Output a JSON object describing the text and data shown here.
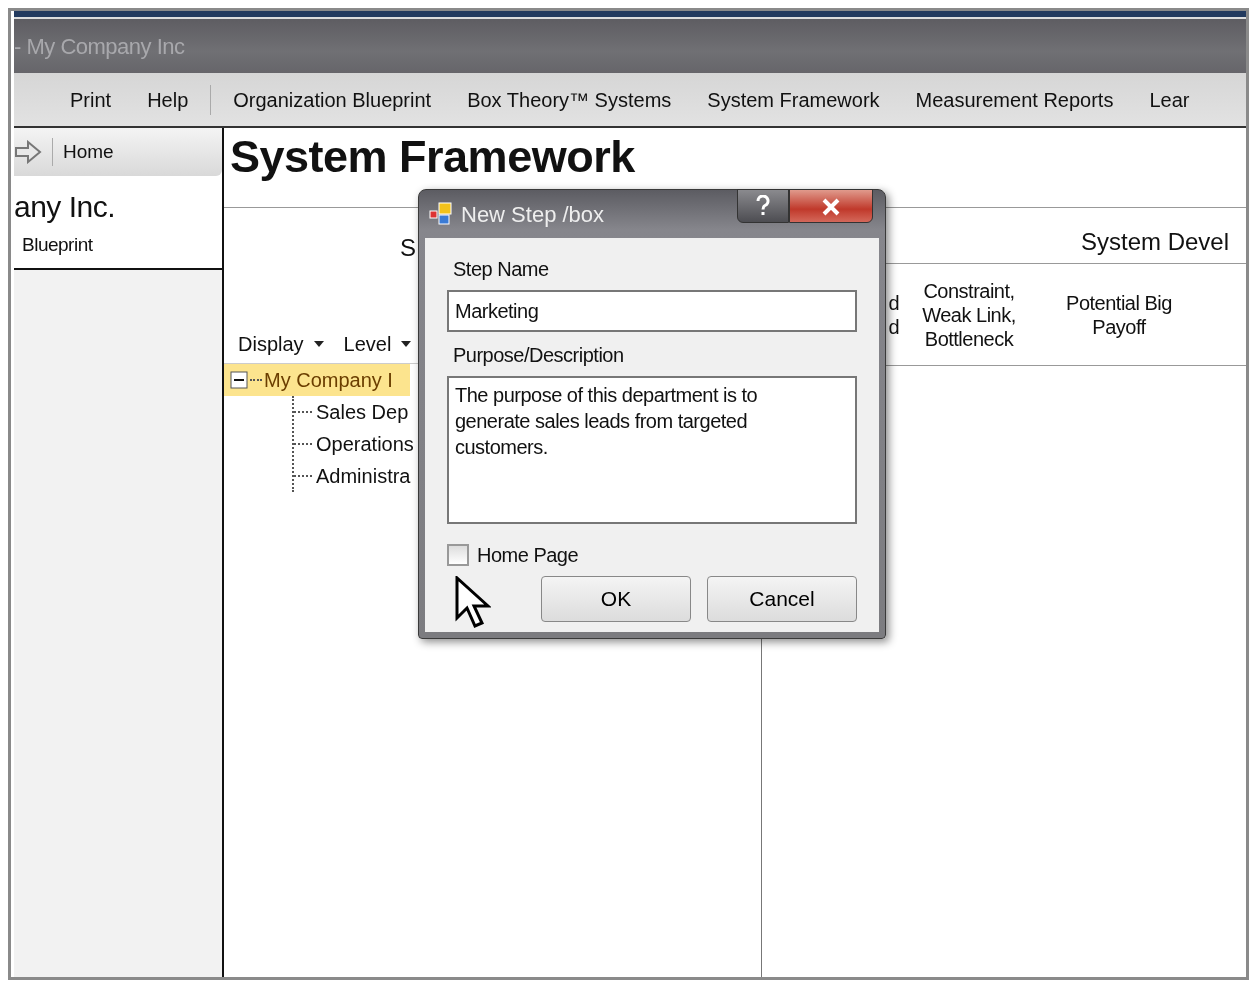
{
  "window": {
    "title": "- My Company Inc"
  },
  "menu": {
    "left": [
      "Print",
      "Help"
    ],
    "main": [
      "Organization Blueprint",
      "Box Theory™ Systems",
      "System Framework",
      "Measurement Reports",
      "Lear"
    ]
  },
  "sidebar": {
    "nav_label": "Home",
    "company": "any Inc.",
    "subtitle": "Blueprint"
  },
  "page": {
    "title": "System Framework",
    "left_header": "S",
    "right_header": "System Devel",
    "columns": [
      "d\nd",
      "Constraint,\nWeak Link,\nBottleneck",
      "Potential Big\nPayoff"
    ],
    "toolbar": [
      "Display",
      "Level"
    ],
    "tree": [
      {
        "label": "My Company I",
        "selected": true,
        "expanded": true,
        "children": [
          {
            "label": "Sales Dep",
            "selected": false
          },
          {
            "label": "Operations",
            "selected": false
          },
          {
            "label": "Administra",
            "selected": false
          }
        ]
      }
    ]
  },
  "dialog": {
    "title": "New Step /box",
    "fields": [
      {
        "kind": "line",
        "label": "Step Name",
        "value": "Marketing"
      },
      {
        "kind": "multiline",
        "label": "Purpose/Description",
        "value": "The purpose of this department is to generate sales leads from targeted customers."
      }
    ],
    "checkbox": {
      "label": "Home Page",
      "checked": false
    },
    "buttons": [
      "OK",
      "Cancel"
    ]
  }
}
